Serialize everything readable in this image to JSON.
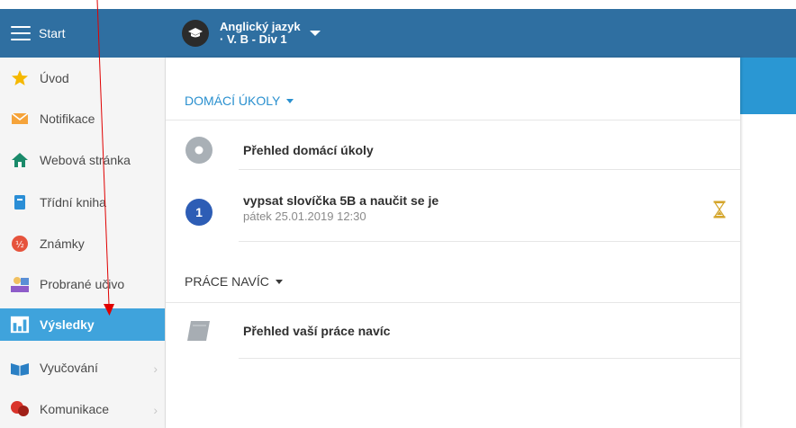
{
  "topbar": {
    "start_label": "Start",
    "course": {
      "title_line1": "Anglický jazyk",
      "title_line2": "· V. B - Div 1"
    }
  },
  "sidebar": {
    "items": [
      {
        "label": "Úvod",
        "icon": "star-icon"
      },
      {
        "label": "Notifikace",
        "icon": "envelope-icon"
      },
      {
        "label": "Webová stránka",
        "icon": "home-icon"
      },
      {
        "label": "Třídní kniha",
        "icon": "book-icon"
      },
      {
        "label": "Známky",
        "icon": "grades-icon"
      },
      {
        "label": "Probrané učivo",
        "icon": "teacher-icon"
      },
      {
        "label": "Výsledky",
        "icon": "bar-chart-icon",
        "active": true
      },
      {
        "label": "Vyučování",
        "icon": "open-book-icon",
        "has_submenu": true
      },
      {
        "label": "Komunikace",
        "icon": "chat-icon",
        "has_submenu": true
      }
    ]
  },
  "homework": {
    "heading": "DOMÁCÍ ÚKOLY",
    "overview_label": "Přehled domácí úkoly",
    "task": {
      "number": "1",
      "title": "vypsat slovíčka 5B a naučit se je",
      "date": "pátek 25.01.2019 12:30"
    }
  },
  "extra_work": {
    "heading": "PRÁCE NAVÍC",
    "overview_label": "Přehled vaší práce navíc"
  },
  "colors": {
    "topbar": "#2f6fa1",
    "active": "#3fa3dc",
    "heading_blue": "#2a90cf",
    "annotation_arrow": "#e00000"
  }
}
